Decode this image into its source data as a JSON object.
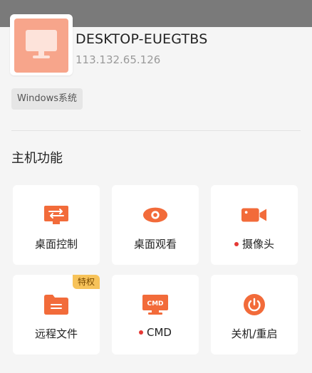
{
  "colors": {
    "accent": "#f26b3a",
    "thumb": "#f7a58b",
    "badge": "#f7c35a",
    "status_dot": "#e53935"
  },
  "device": {
    "name": "DESKTOP-EUEGTBS",
    "ip": "113.132.65.126",
    "os_tag": "Windows系统",
    "icon": "monitor-icon"
  },
  "section": {
    "title": "主机功能"
  },
  "features": [
    {
      "label": "桌面控制",
      "icon": "remote-desktop-icon",
      "status_dot": false,
      "badge": ""
    },
    {
      "label": "桌面观看",
      "icon": "eye-icon",
      "status_dot": false,
      "badge": ""
    },
    {
      "label": "摄像头",
      "icon": "camera-icon",
      "status_dot": true,
      "badge": ""
    },
    {
      "label": "远程文件",
      "icon": "folder-icon",
      "status_dot": false,
      "badge": "特权"
    },
    {
      "label": "CMD",
      "icon": "cmd-icon",
      "status_dot": true,
      "badge": ""
    },
    {
      "label": "关机/重启",
      "icon": "power-icon",
      "status_dot": false,
      "badge": ""
    }
  ]
}
